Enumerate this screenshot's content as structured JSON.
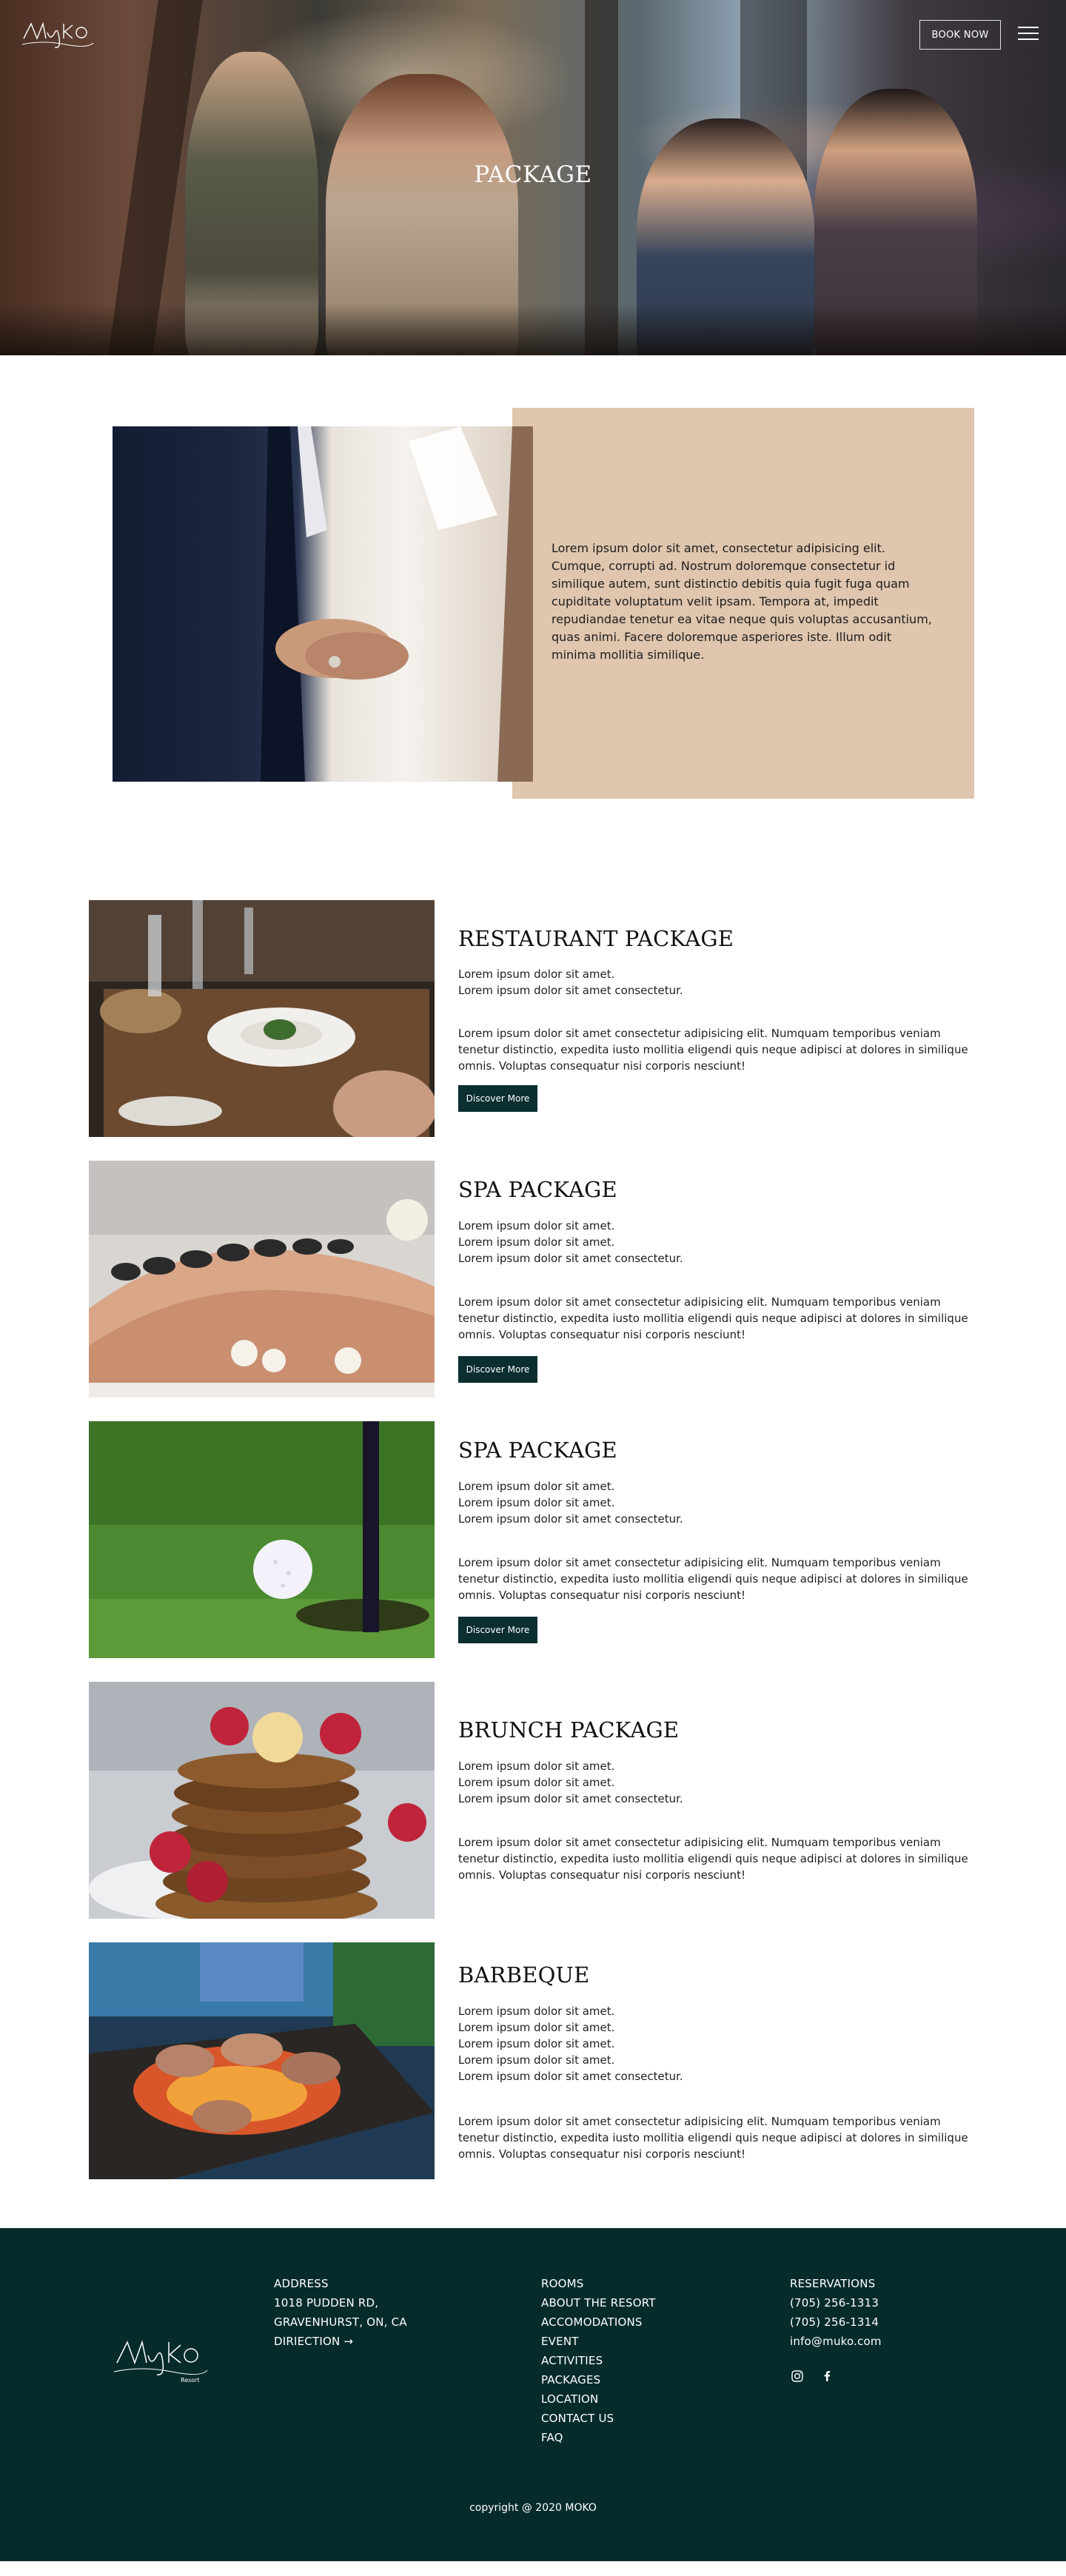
{
  "header": {
    "logo_alt": "Muko Resort",
    "book_now": "BOOK NOW",
    "hero_title": "PACKAGE"
  },
  "intro": {
    "text": "Lorem ipsum dolor sit amet, consectetur adipisicing elit. Cumque, corrupti ad. Nostrum doloremque consectetur id similique autem, sunt distinctio debitis quia fugit fuga quam cupiditate voluptatum velit ipsam. Tempora at, impedit repudiandae tenetur ea vitae neque quis voluptas accusantium, quas animi. Facere doloremque asperiores iste. Illum odit minima mollitia similique."
  },
  "packages": [
    {
      "title": "RESTAURANT PACKAGE",
      "lines": [
        "Lorem ipsum dolor sit amet.",
        "Lorem ipsum dolor sit amet consectetur."
      ],
      "description": "Lorem ipsum dolor sit amet consectetur adipisicing elit. Numquam temporibus veniam tenetur distinctio, expedita iusto mollitia eligendi quis neque adipisci at dolores in similique omnis. Voluptas consequatur nisi corporis nesciunt!",
      "button": "Discover More"
    },
    {
      "title": "SPA PACKAGE",
      "lines": [
        "Lorem ipsum dolor sit amet.",
        "Lorem ipsum dolor sit amet.",
        "Lorem ipsum dolor sit amet consectetur."
      ],
      "description": "Lorem ipsum dolor sit amet consectetur adipisicing elit. Numquam temporibus veniam tenetur distinctio, expedita iusto mollitia eligendi quis neque adipisci at dolores in similique omnis. Voluptas consequatur nisi corporis nesciunt!",
      "button": "Discover More"
    },
    {
      "title": "SPA PACKAGE",
      "lines": [
        "Lorem ipsum dolor sit amet.",
        "Lorem ipsum dolor sit amet.",
        "Lorem ipsum dolor sit amet consectetur."
      ],
      "description": "Lorem ipsum dolor sit amet consectetur adipisicing elit. Numquam temporibus veniam tenetur distinctio, expedita iusto mollitia eligendi quis neque adipisci at dolores in similique omnis. Voluptas consequatur nisi corporis nesciunt!",
      "button": "Discover More"
    },
    {
      "title": "BRUNCH PACKAGE",
      "lines": [
        "Lorem ipsum dolor sit amet.",
        "Lorem ipsum dolor sit amet.",
        "Lorem ipsum dolor sit amet consectetur."
      ],
      "description": "Lorem ipsum dolor sit amet consectetur adipisicing elit. Numquam temporibus veniam tenetur distinctio, expedita iusto mollitia eligendi quis neque adipisci at dolores in similique omnis. Voluptas consequatur nisi corporis nesciunt!"
    },
    {
      "title": "BARBEQUE",
      "lines": [
        "Lorem ipsum dolor sit amet.",
        "Lorem ipsum dolor sit amet.",
        "Lorem ipsum dolor sit amet.",
        "Lorem ipsum dolor sit amet.",
        "Lorem ipsum dolor sit amet consectetur."
      ],
      "description": "Lorem ipsum dolor sit amet consectetur adipisicing elit. Numquam temporibus veniam tenetur distinctio, expedita iusto mollitia eligendi quis neque adipisci at dolores in similique omnis. Voluptas consequatur nisi corporis nesciunt!"
    }
  ],
  "footer": {
    "address_lines": [
      "ADDRESS",
      "1018 PUDDEN RD,",
      "GRAVENHURST, ON, CA"
    ],
    "direction": "DIRIECTION →",
    "nav": [
      "ROOMS",
      "ABOUT THE RESORT",
      "ACCOMODATIONS",
      "EVENT",
      "ACTIVITIES",
      "PACKAGES",
      "LOCATION",
      "CONTACT US",
      "FAQ"
    ],
    "reservations_label": "RESERVATIONS",
    "phones": [
      "(705) 256-1313",
      "(705) 256-1314"
    ],
    "email": "info@muko.com",
    "social": [
      "instagram-icon",
      "facebook-icon"
    ],
    "copyright": "copyright @ 2020 MOKO"
  },
  "colors": {
    "accent_dark": "#0b2e30",
    "footer_bg": "#072b2b",
    "intro_box": "#e0c6ae"
  }
}
